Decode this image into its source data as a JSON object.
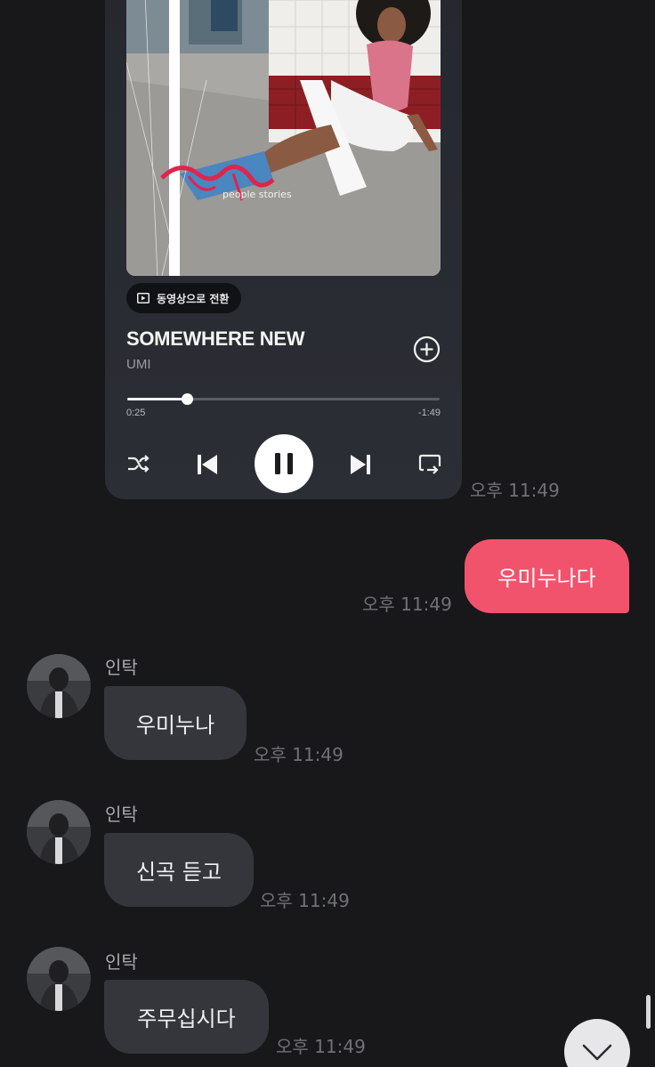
{
  "music_card": {
    "cover_caption": "people stories",
    "video_switch_label": "동영상으로 전환",
    "song_title": "SOMEWHERE NEW",
    "artist": "UMI",
    "progress": 0.19,
    "elapsed": "0:25",
    "remaining": "-1:49",
    "timestamp": "오후 11:49",
    "icons": {
      "video": "play-square-icon",
      "add": "plus-circle-icon",
      "shuffle": "shuffle-icon",
      "previous": "skip-previous-icon",
      "pause": "pause-icon",
      "next": "skip-next-icon",
      "repeat": "repeat-icon"
    }
  },
  "messages": [
    {
      "direction": "out",
      "text": "우미누나다",
      "time": "오후 11:49"
    },
    {
      "direction": "in",
      "sender": "인탁",
      "text": "우미누나",
      "time": "오후 11:49"
    },
    {
      "direction": "in",
      "sender": "인탁",
      "text": "신곡 듣고",
      "time": "오후 11:49"
    },
    {
      "direction": "in",
      "sender": "인탁",
      "text": "주무십시다",
      "time": "오후 11:49"
    }
  ],
  "colors": {
    "background": "#18181b",
    "outgoing_bubble": "#f2536c",
    "incoming_bubble": "#34363c",
    "card": "#2b2e34"
  },
  "scroll_down_icon": "chevron-down-icon"
}
